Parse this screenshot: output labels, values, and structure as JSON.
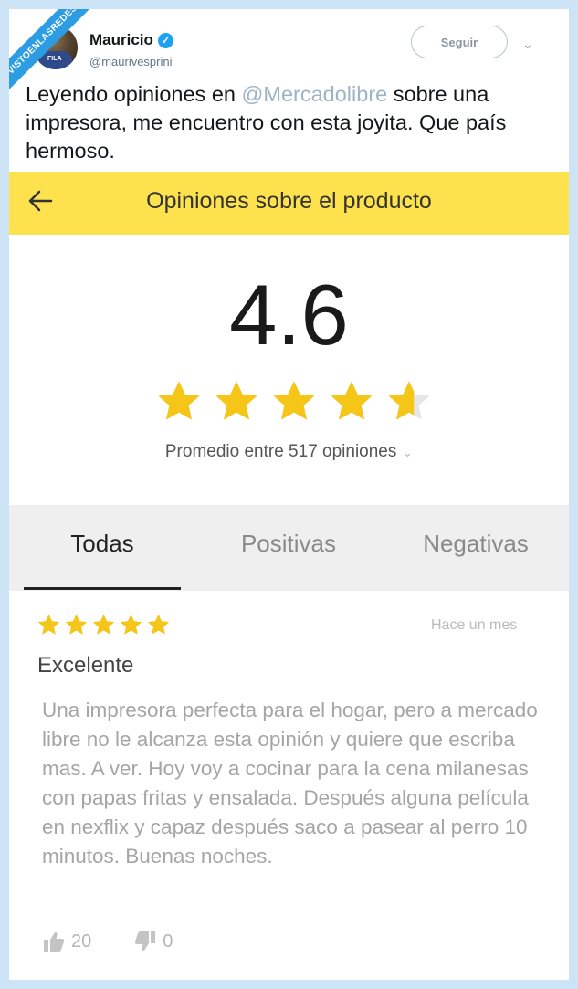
{
  "watermark": "VISTOENLASREDES",
  "tweet": {
    "name": "Mauricio",
    "handle": "@maurivesprini",
    "follow_label": "Seguir",
    "text_before": "Leyendo opiniones en ",
    "mention": "@Mercadolibre",
    "text_after": " sobre una impresora, me encuentro con esta joyita. Que país hermoso.",
    "avatar_text": "FILA"
  },
  "app": {
    "title": "Opiniones sobre el producto",
    "rating": "4.6",
    "rating_stars": 4.6,
    "summary": "Promedio entre 517 opiniones",
    "tabs": [
      "Todas",
      "Positivas",
      "Negativas"
    ],
    "active_tab": "Todas",
    "review": {
      "stars": 5,
      "date": "Hace un mes",
      "title": "Excelente",
      "body": "Una impresora perfecta para el hogar, pero a mercado libre no le alcanza esta opinión y quiere que escriba mas. A ver. Hoy voy a cocinar para la cena milanesas con papas fritas y ensalada. Después alguna película en nexflix y capaz después saco a pasear al perro 10 minutos. Buenas noches.",
      "likes": "20",
      "dislikes": "0"
    }
  },
  "colors": {
    "appbar": "#fde14d",
    "star": "#f5c518",
    "star_empty": "#e6e6e6",
    "twitter_blue": "#1da1f2"
  }
}
